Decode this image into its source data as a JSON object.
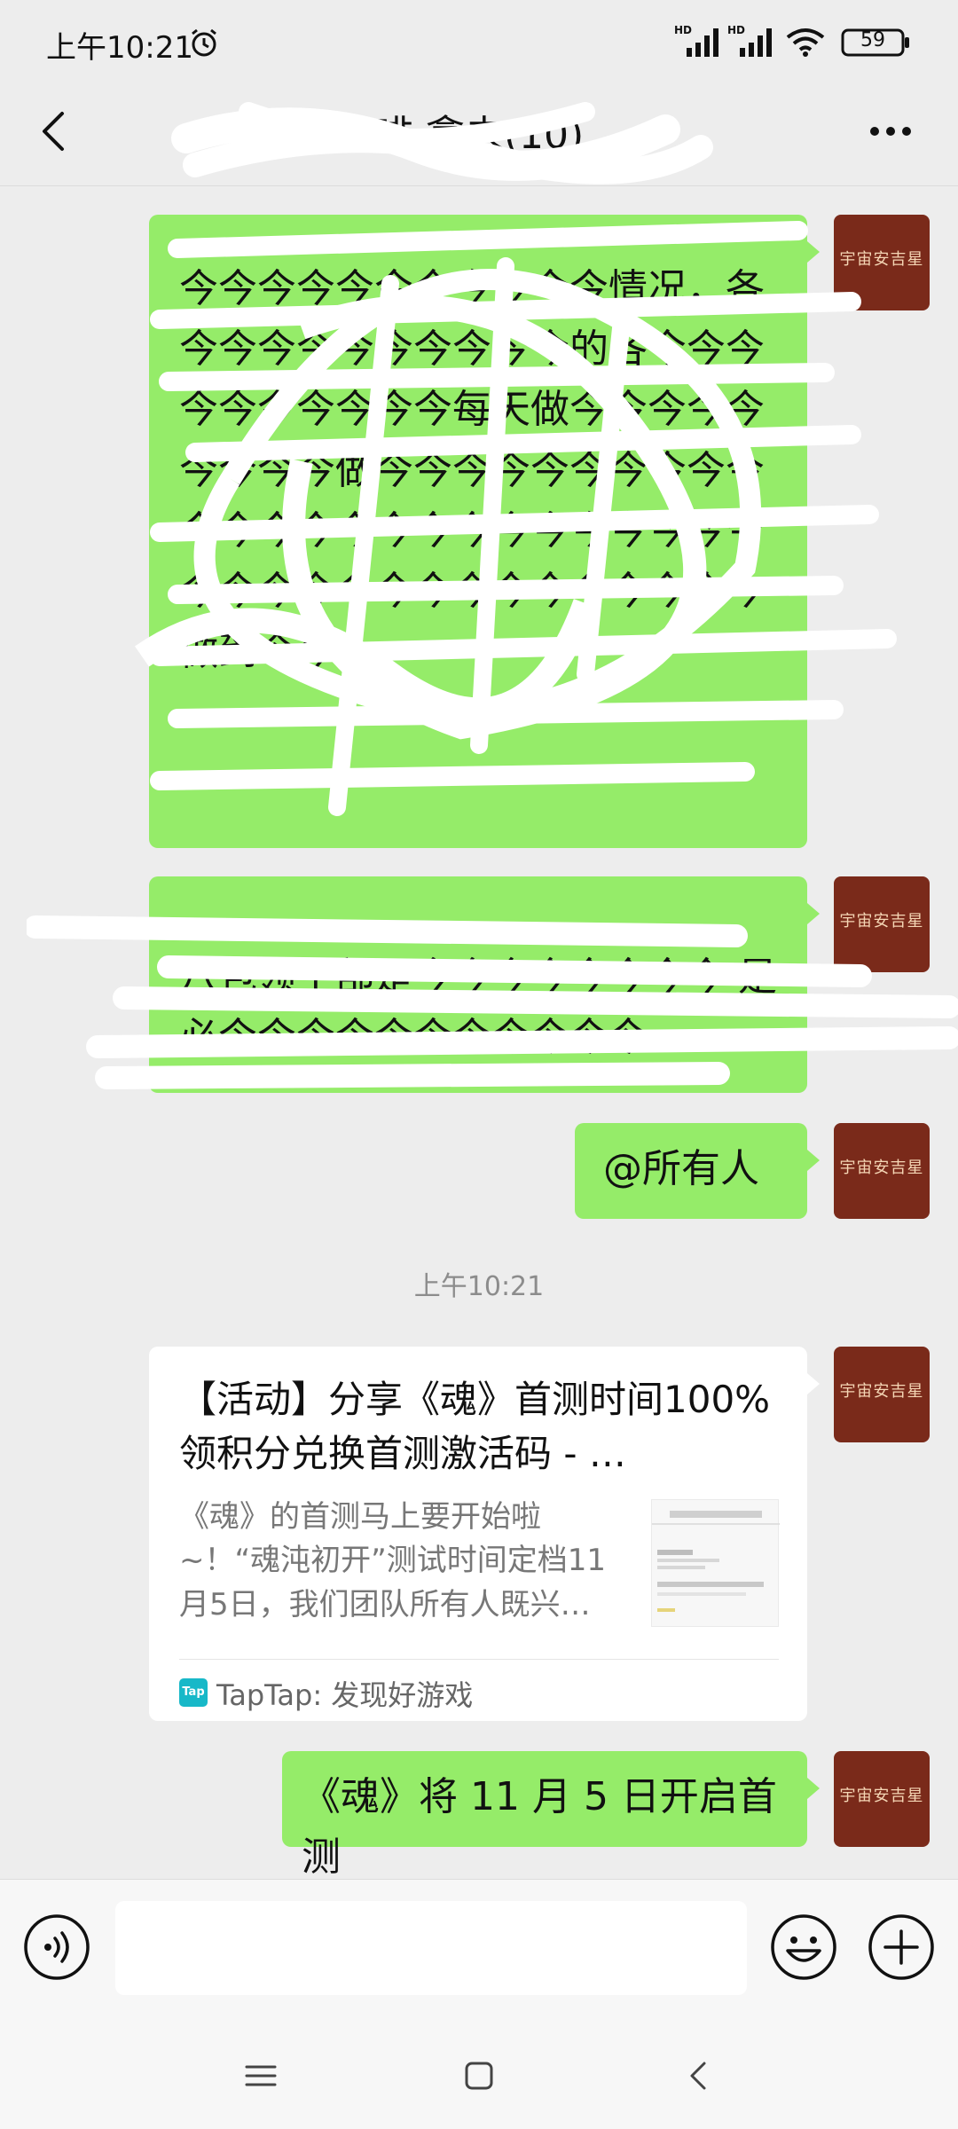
{
  "status_bar": {
    "time": "上午10:21",
    "network_1": "HD",
    "network_2": "HD",
    "battery": "59"
  },
  "header": {
    "title": "啡                 拿未(10)"
  },
  "messages": [
    {
      "type": "text",
      "sender": "self",
      "text": "今今今今今今今今今今今情况，各今今今今今今今今今今的各今今今今今今今今今今每天做今今今今今今今今今做今今今今今今今今今今今今今今今今今今今今今今今今今今今今今今今今今今今今今今今今做到今今",
      "redacted": true
    },
    {
      "type": "text",
      "sender": "self",
      "text": "八包领干部是今今今今今今今今 是必今今今今今今今今今今今",
      "redacted": true
    },
    {
      "type": "text",
      "sender": "self",
      "text": "@所有人"
    },
    {
      "type": "time",
      "text": "上午10:21"
    },
    {
      "type": "link",
      "sender": "self",
      "title": "【活动】分享《魂》首测时间100%领积分兑换首测激活码 - …",
      "desc": "《魂》的首测马上要开始啦~！“魂沌初开”测试时间定档11月5日，我们团队所有人既兴…",
      "source": "TapTap: 发现好游戏",
      "source_icon": "Tap"
    },
    {
      "type": "text",
      "sender": "self",
      "text": "《魂》将 11 月 5 日开启首测"
    }
  ],
  "avatar_label": "宇宙安吉星",
  "colors": {
    "bubble_self": "#95ec69",
    "background": "#ededed",
    "avatar": "#7a2a1a",
    "taptap": "#17b8c8"
  }
}
